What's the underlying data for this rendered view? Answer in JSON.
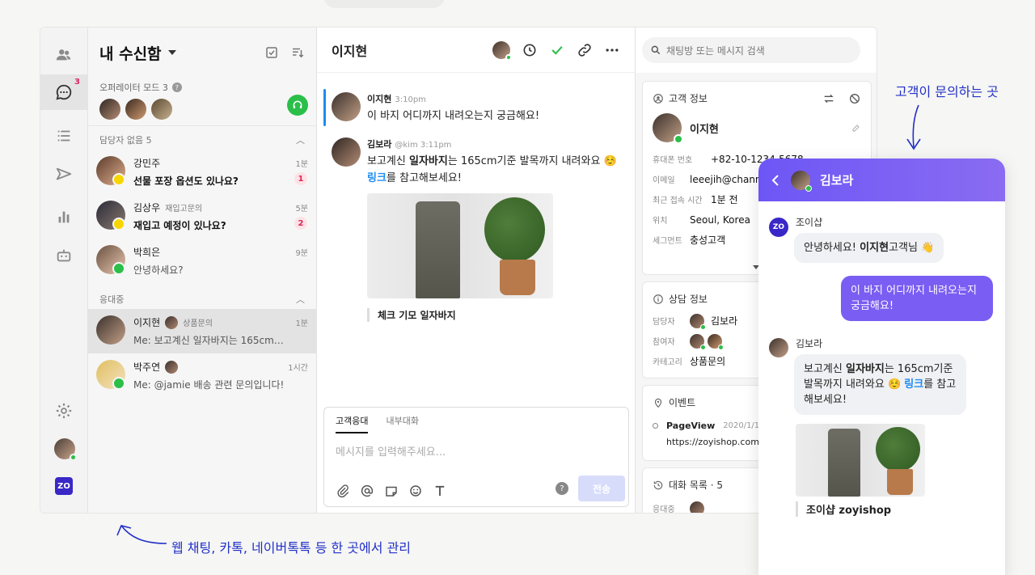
{
  "colors": {
    "accent": "#3a27c7",
    "online": "#2bbf4a",
    "link": "#1e8cf0",
    "annotation": "#2230c8",
    "widget_header": "#7a5df3",
    "unread": "#e0245e"
  },
  "rail": {
    "inbox_badge": "3",
    "logo": "ZO"
  },
  "inbox": {
    "title": "내 수신함",
    "operator_mode": "오퍼레이터 모드 3",
    "help_icon": "?",
    "unassigned_label": "담당자 없음 5",
    "in_progress_label": "응대중",
    "conversations": [
      {
        "name": "강민주",
        "sub": "",
        "message": "선물 포장 옵션도 있나요?",
        "time": "1분",
        "unread": "1"
      },
      {
        "name": "김상우",
        "sub": "재입고문의",
        "message": "재입고 예정이 있나요?",
        "time": "5분",
        "unread": "2"
      },
      {
        "name": "박희은",
        "sub": "",
        "message": "안녕하세요?",
        "time": "9분",
        "unread": ""
      },
      {
        "name": "이지현",
        "sub": "상품문의",
        "message": "Me: 보고계신 일자바지는 165cm…",
        "time": "1분",
        "unread": ""
      },
      {
        "name": "박주연",
        "sub": "",
        "message": "Me: @jamie 배송 관련 문의입니다!",
        "time": "1시간",
        "unread": ""
      }
    ]
  },
  "chat": {
    "title": "이지현",
    "search_placeholder": "채팅방 또는 메시지 검색",
    "messages": [
      {
        "name": "이지현",
        "meta": "3:10pm",
        "text": "이 바지 어디까지 내려오는지 궁금해요!"
      },
      {
        "name": "김보라",
        "meta": "@kim  3:11pm",
        "text_a": "보고계신 ",
        "text_b": "일자바지",
        "text_c": "는 165cm기준 발목까지 내려와요 ☺️",
        "link": "링크",
        "text_d": "를 참고해보세요!",
        "caption": "체크 기모 일자바지"
      }
    ],
    "composer": {
      "tab_customer": "고객응대",
      "tab_internal": "내부대화",
      "placeholder": "메시지를 입력해주세요...",
      "help": "?",
      "send": "전송"
    }
  },
  "info": {
    "customer_title": "고객 정보",
    "customer_name": "이지현",
    "fields": [
      {
        "k": "휴대폰 번호",
        "v": "+82-10-1234-5678"
      },
      {
        "k": "이메일",
        "v": "leeejih@channel."
      },
      {
        "k": "최근 접속 시간",
        "v": "1분 전"
      },
      {
        "k": "위치",
        "v": "Seoul, Korea"
      },
      {
        "k": "세그먼트",
        "v": "충성고객"
      }
    ],
    "consult_title": "상담 정보",
    "manager_label": "담당자",
    "manager_value": "김보라",
    "participant_label": "참여자",
    "category_label": "카테고리",
    "category_value": "상품문의",
    "event_title": "이벤트",
    "event_name": "PageView",
    "event_date": "2020/1/1",
    "event_url": "https://zoyishop.com",
    "history_title": "대화 목록 · 5",
    "history_status": "응대중"
  },
  "widget": {
    "title": "김보라",
    "logo": "ZO",
    "shop_name": "조이샵",
    "greet_a": "안녕하세요! ",
    "greet_b": "이지현",
    "greet_c": "고객님 👋",
    "customer_msg": "이 바지 어디까지 내려오는지 궁금해요!",
    "agent_name": "김보라",
    "reply_a": "보고계신 ",
    "reply_b": "일자바지",
    "reply_c": "는 165cm기준 발목까지 내려와요 ☺️ ",
    "reply_link": "링크",
    "reply_d": "를 참고해보세요!",
    "caption": "조이샵 zoyishop"
  },
  "annotations": {
    "top": "고객이 문의하는 곳",
    "bottom": "웹 채팅, 카톡, 네이버톡톡 등 한 곳에서 관리"
  }
}
